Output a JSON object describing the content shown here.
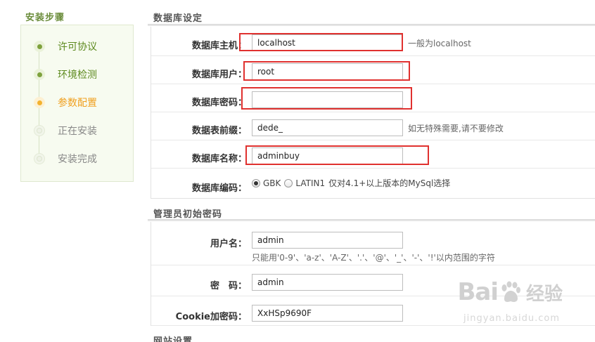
{
  "sidebar": {
    "title": "安装步骤",
    "steps": [
      {
        "label": "许可协议",
        "state": "done"
      },
      {
        "label": "环境检测",
        "state": "done"
      },
      {
        "label": "参数配置",
        "state": "current"
      },
      {
        "label": "正在安装",
        "state": "pending"
      },
      {
        "label": "安装完成",
        "state": "pending"
      }
    ]
  },
  "db": {
    "title": "数据库设定",
    "host": {
      "label": "数据库主机：",
      "value": "localhost",
      "hint": "一般为localhost"
    },
    "user": {
      "label": "数据库用户：",
      "value": "root"
    },
    "password": {
      "label": "数据库密码：",
      "value": ""
    },
    "prefix": {
      "label": "数据表前缀：",
      "value": "dede_",
      "hint": "如无特殊需要,请不要修改"
    },
    "name": {
      "label": "数据库名称：",
      "value": "adminbuy"
    },
    "charset": {
      "label": "数据库编码：",
      "options": [
        "GBK",
        "LATIN1"
      ],
      "selected": "GBK",
      "note": "仅对4.1+以上版本的MySql选择"
    }
  },
  "admin": {
    "title": "管理员初始密码",
    "username": {
      "label": "用户名：",
      "value": "admin",
      "hint": "只能用'0-9'、'a-z'、'A-Z'、'.'、'@'、'_'、'-'、'!'以内范围的字符"
    },
    "password": {
      "label": "密　码：",
      "value": "admin"
    },
    "cookie": {
      "label": "Cookie加密码：",
      "value": "XxHSp9690F"
    }
  },
  "site": {
    "title": "网站设置"
  },
  "watermark": {
    "brand": "Bai",
    "brand2": "经验",
    "url": "jingyan.baidu.com"
  },
  "colors": {
    "accent_green": "#6a8c3a",
    "current_orange": "#f0a020",
    "highlight_red": "#e0312f"
  }
}
